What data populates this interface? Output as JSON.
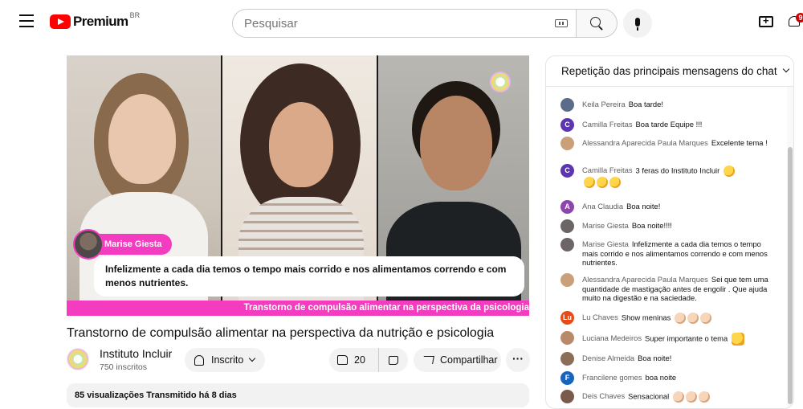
{
  "header": {
    "logo_text": "Premium",
    "logo_region": "BR",
    "search_placeholder": "Pesquisar",
    "notification_count": "9",
    "brand_color": "#ff0000"
  },
  "video": {
    "caption_name": "Marise Giesta",
    "caption_text": "Infelizmente a cada dia temos o tempo mais corrido e nos alimentamos correndo e com menos nutrientes.",
    "ticker": "Transtorno de compulsão alimentar na perspectiva da psicologia",
    "overlay_color": "#f43cc0",
    "title": "Transtorno de compulsão alimentar na perspectiva da nutrição e psicologia"
  },
  "channel": {
    "name": "Instituto Incluir",
    "subscribers": "750 inscritos",
    "subscribe_label": "Inscrito",
    "likes": "20",
    "share_label": "Compartilhar",
    "more_label": "···"
  },
  "description": {
    "stats": "85 visualizações  Transmitido há 8 dias"
  },
  "chat": {
    "header": "Repetição das principais mensagens do chat",
    "messages": [
      {
        "author": "Keila Pereira",
        "text": "Boa tarde!",
        "avatar": "",
        "avatar_color": "#5b6b8a"
      },
      {
        "author": "Camilla Freitas",
        "text": "Boa tarde Equipe !!!",
        "avatar": "C",
        "avatar_color": "#5e35b1"
      },
      {
        "author": "Alessandra Aparecida Paula Marques",
        "text": "Excelente tema !",
        "avatar": "",
        "avatar_color": "#c9a07a"
      },
      {
        "author": "Camilla Freitas",
        "text": "3 feras do Instituto Incluir",
        "avatar": "C",
        "avatar_color": "#5e35b1"
      },
      {
        "author": "Ana Claudia",
        "text": "Boa noite!",
        "avatar": "A",
        "avatar_color": "#8e44ad"
      },
      {
        "author": "Marise Giesta",
        "text": "Boa noite!!!!",
        "avatar": "",
        "avatar_color": "#6d6565"
      },
      {
        "author": "Marise Giesta",
        "text": "Infelizmente a cada dia temos o tempo mais corrido e nos alimentamos correndo e com menos nutrientes.",
        "avatar": "",
        "avatar_color": "#6d6565"
      },
      {
        "author": "Alessandra Aparecida Paula Marques",
        "text": "Sei que tem uma quantidade de mastigação antes de engolir . Que ajuda muito na digestão e na saciedade.",
        "avatar": "",
        "avatar_color": "#c9a07a"
      },
      {
        "author": "Lu Chaves",
        "text": "Show meninas",
        "avatar": "Lu",
        "avatar_color": "#e64a19"
      },
      {
        "author": "Luciana Medeiros",
        "text": "Super importante o tema",
        "avatar": "",
        "avatar_color": "#b98a6a"
      },
      {
        "author": "Denise Almeida",
        "text": "Boa noite!",
        "avatar": "",
        "avatar_color": "#8a6e5a"
      },
      {
        "author": "Francilene gomes",
        "text": "boa noite",
        "avatar": "F",
        "avatar_color": "#1565c0"
      },
      {
        "author": "Deis Chaves",
        "text": "Sensacional",
        "avatar": "",
        "avatar_color": "#7a5a4a"
      }
    ]
  }
}
